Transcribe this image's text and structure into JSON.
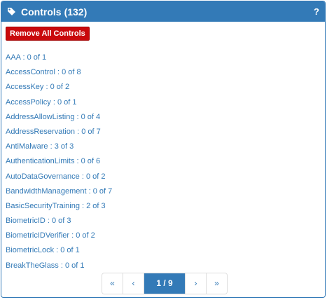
{
  "header": {
    "title": "Controls",
    "count": "(132)",
    "help_label": "?"
  },
  "toolbar": {
    "remove_all_label": "Remove All Controls"
  },
  "controls": [
    "AAA : 0 of 1",
    "AccessControl : 0 of 8",
    "AccessKey : 0 of 2",
    "AccessPolicy : 0 of 1",
    "AddressAllowListing : 0 of 4",
    "AddressReservation : 0 of 7",
    "AntiMalware : 3 of 3",
    "AuthenticationLimits : 0 of 6",
    "AutoDataGovernance : 0 of 2",
    "BandwidthManagement : 0 of 7",
    "BasicSecurityTraining : 2 of 3",
    "BiometricID : 0 of 3",
    "BiometricIDVerifier : 0 of 2",
    "BiometricLock : 0 of 1",
    "BreakTheGlass : 0 of 1"
  ],
  "pagination": {
    "first_label": "«",
    "prev_label": "‹",
    "current_label": "1 / 9",
    "next_label": "›",
    "last_label": "»"
  },
  "colors": {
    "header_bg": "#337ab7",
    "link": "#337ab7",
    "danger": "#c9090c"
  },
  "icons": {
    "header": "tag-icon",
    "help": "question-icon"
  }
}
